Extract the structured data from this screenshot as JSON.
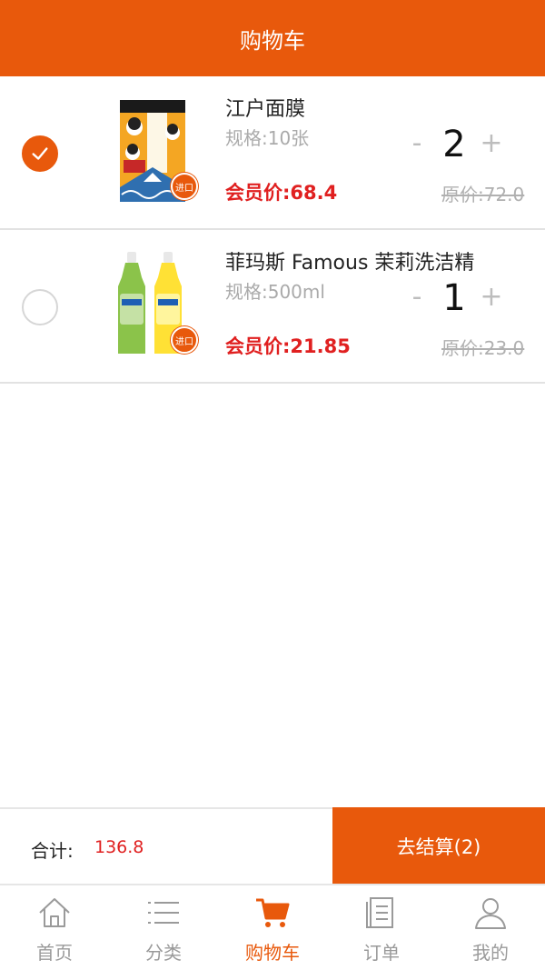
{
  "header": {
    "title": "购物车"
  },
  "cart": {
    "items": [
      {
        "name": "江户面膜",
        "spec": "规格:10张",
        "member_price": "会员价:68.4",
        "quantity": "2",
        "minus": "-",
        "plus": "+",
        "original_price": "原价:72.0",
        "badge": "进口",
        "checked": true
      },
      {
        "name": "菲玛斯 Famous 茉莉洗洁精",
        "spec": "规格:500ml",
        "member_price": "会员价:21.85",
        "quantity": "1",
        "minus": "-",
        "plus": "+",
        "original_price": "原价:23.0",
        "badge": "进口",
        "checked": false
      }
    ]
  },
  "checkout": {
    "total_label": "合计:",
    "total_value": "136.8",
    "button_label": "去结算(2)"
  },
  "tabbar": {
    "tabs": [
      {
        "label": "首页",
        "icon": "home-icon"
      },
      {
        "label": "分类",
        "icon": "list-icon"
      },
      {
        "label": "购物车",
        "icon": "cart-icon",
        "active": true
      },
      {
        "label": "订单",
        "icon": "order-icon"
      },
      {
        "label": "我的",
        "icon": "user-icon"
      }
    ]
  },
  "colors": {
    "accent": "#E8590C",
    "price_red": "#E02020",
    "muted": "#9a9a9a"
  }
}
